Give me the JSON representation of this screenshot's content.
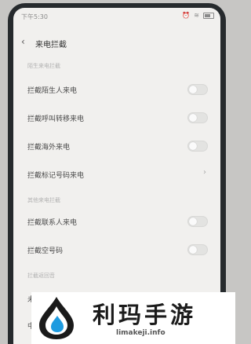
{
  "status_bar": {
    "time": "下午5:30"
  },
  "header": {
    "title": "来电拦截"
  },
  "sections": [
    {
      "header": "陌生来电拦截"
    },
    {
      "header": "其他来电拦截"
    },
    {
      "header": "拦截返回音"
    }
  ],
  "settings": [
    {
      "label": "拦截陌生人来电",
      "control": "toggle",
      "on": false
    },
    {
      "label": "拦截呼叫转移来电",
      "control": "toggle",
      "on": false
    },
    {
      "label": "拦截海外来电",
      "control": "toggle",
      "on": false
    },
    {
      "label": "拦截标记号码来电",
      "control": "chevron"
    },
    {
      "label": "拦截联系人来电",
      "control": "toggle",
      "on": false
    },
    {
      "label": "拦截空号码",
      "control": "toggle",
      "on": false
    }
  ],
  "partial_items": [
    {
      "label": "未接..."
    },
    {
      "label": "中国..."
    }
  ],
  "watermark": {
    "brand": "利玛手游",
    "url": "limakeji.info"
  },
  "colors": {
    "screen_bg": "#f1f0ee",
    "text": "#4a4a4a",
    "section_header": "#b2b2b2",
    "toggle_off": "#e3e3e1"
  },
  "icons": {
    "back": "chevron-left",
    "wifi": "wifi",
    "battery": "battery"
  }
}
